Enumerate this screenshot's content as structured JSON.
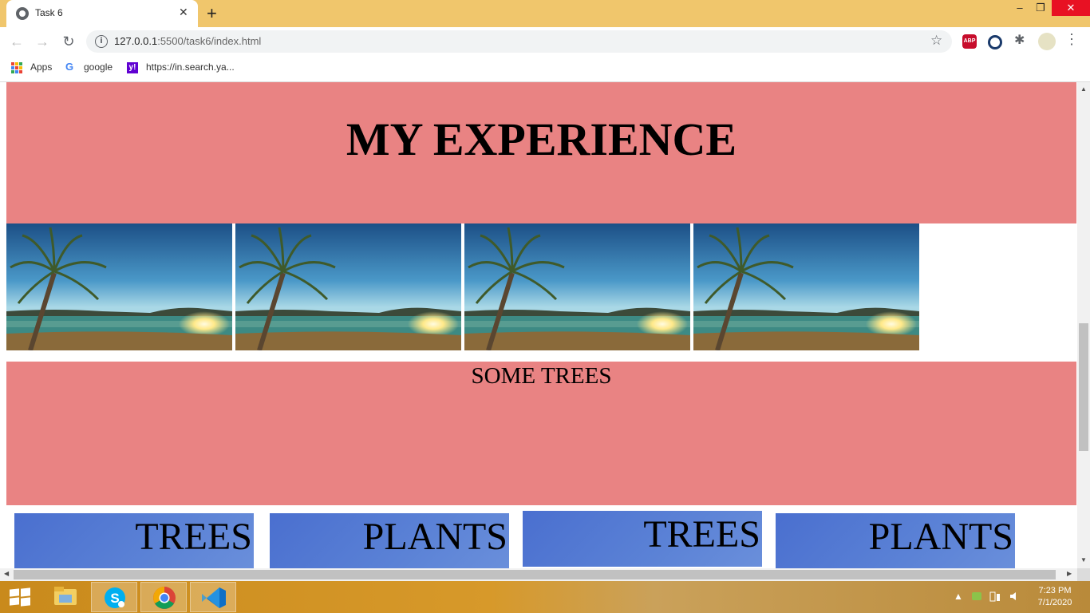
{
  "browser": {
    "tab_title": "Task 6",
    "url_host": "127.0.0.1",
    "url_rest": ":5500/task6/index.html",
    "bookmarks": [
      {
        "label": "Apps"
      },
      {
        "label": "google"
      },
      {
        "label": "https://in.search.ya..."
      }
    ],
    "icons": [
      "back-icon",
      "forward-icon",
      "reload-icon",
      "info-icon",
      "star-icon",
      "adblock-icon",
      "lens-icon",
      "extensions-icon",
      "profile-avatar",
      "menu-icon"
    ]
  },
  "page": {
    "heading": "MY EXPERIENCE",
    "subheading": "SOME TREES",
    "photos": [
      "palm-beach",
      "palm-beach",
      "palm-beach",
      "palm-beach"
    ],
    "cards": [
      {
        "label": "TREES"
      },
      {
        "label": "PLANTS"
      },
      {
        "label": "TREES"
      },
      {
        "label": "PLANTS"
      }
    ],
    "colors": {
      "section_bg": "#e98383",
      "card_bg": "#5b82d6"
    }
  },
  "taskbar": {
    "apps": [
      "file-explorer-icon",
      "skype-icon",
      "chrome-icon",
      "vscode-icon"
    ],
    "time": "7:23 PM",
    "date": "7/1/2020"
  }
}
